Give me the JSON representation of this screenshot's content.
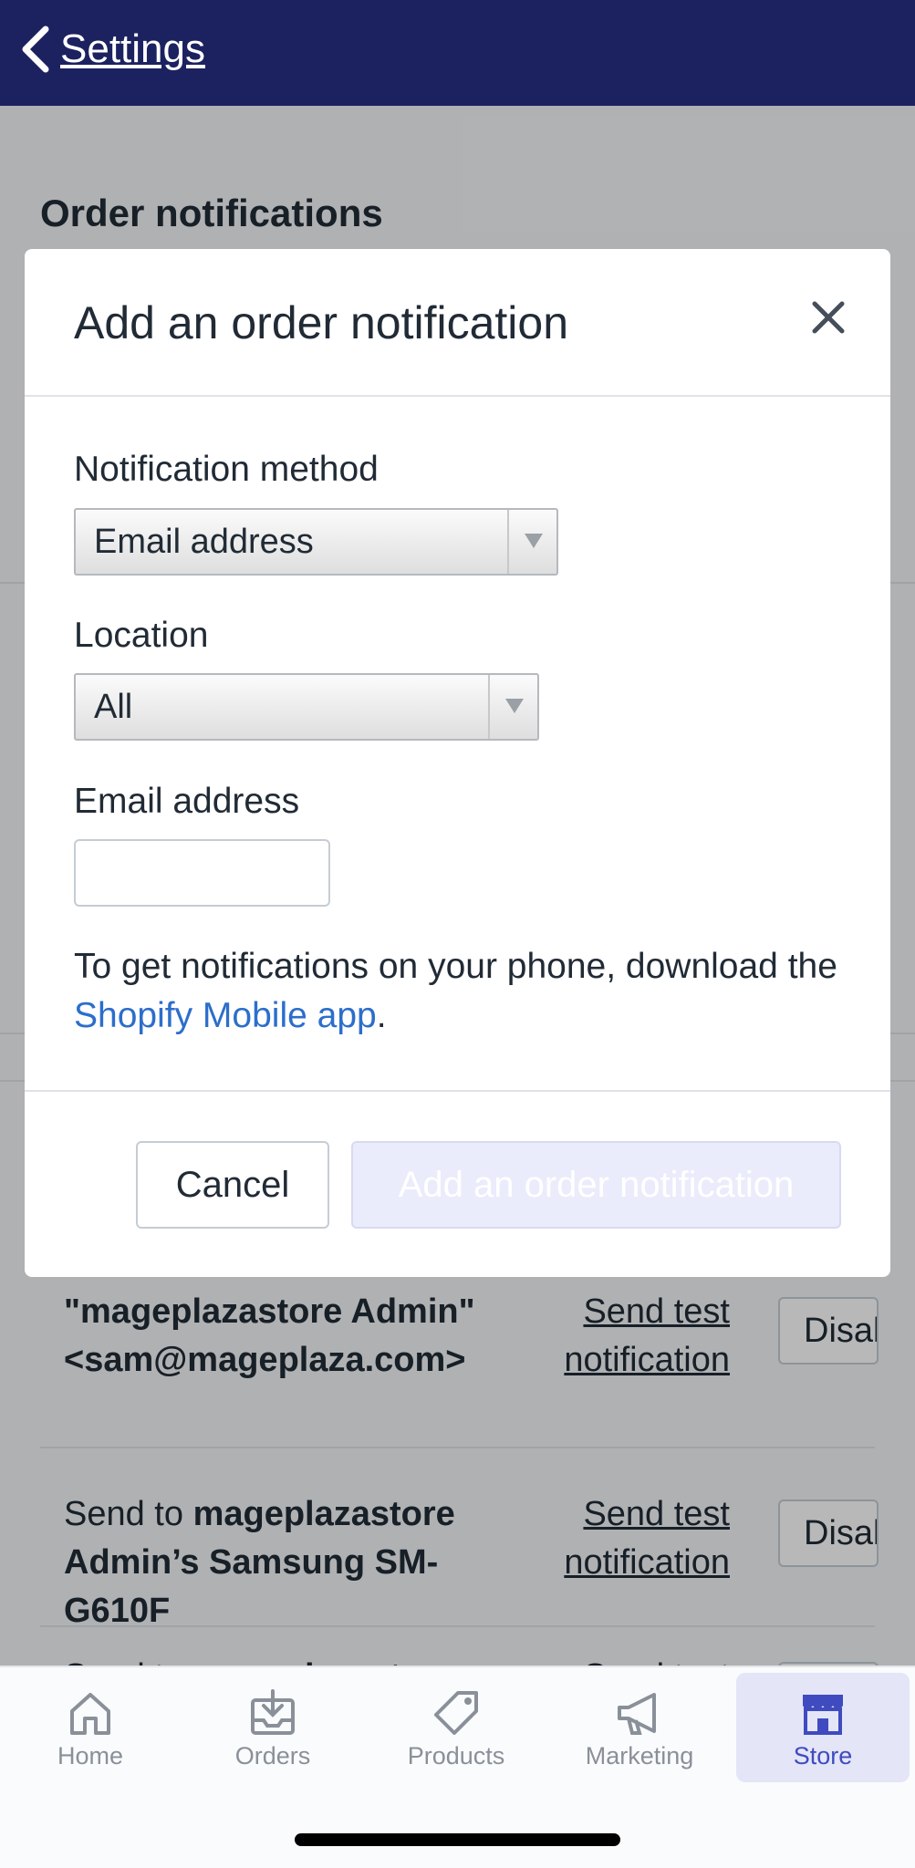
{
  "header": {
    "back_label": "Settings"
  },
  "page": {
    "section_title": "Order notifications",
    "rows": [
      {
        "text_html": "<b>\"mageplazastore Admin\" &lt;sam@mageplaza.com&gt;</b>",
        "link": "Send test notification",
        "button": "Disable"
      },
      {
        "text_html": "Send to <b>mageplazastore Admin’s Samsung SM-G610F</b>",
        "link": "Send test notification",
        "button": "Disable"
      },
      {
        "text_html": "Send to <b>mageplazastore</b>",
        "link": "Send test",
        "button": ""
      }
    ]
  },
  "modal": {
    "title": "Add an order notification",
    "method_label": "Notification method",
    "method_value": "Email address",
    "location_label": "Location",
    "location_value": "All",
    "email_label": "Email address",
    "email_value": "",
    "hint_prefix": "To get notifications on your phone, download the ",
    "hint_link": "Shopify Mobile app",
    "hint_suffix": ".",
    "cancel_label": "Cancel",
    "submit_label": "Add an order notification"
  },
  "tabbar": {
    "items": [
      {
        "label": "Home",
        "icon": "home-icon"
      },
      {
        "label": "Orders",
        "icon": "orders-icon"
      },
      {
        "label": "Products",
        "icon": "tag-icon"
      },
      {
        "label": "Marketing",
        "icon": "megaphone-icon"
      },
      {
        "label": "Store",
        "icon": "store-icon",
        "active": true
      }
    ]
  },
  "colors": {
    "header_bg": "#1c2260",
    "link": "#2c6ecb",
    "active_tab": "#3f4bbf"
  }
}
